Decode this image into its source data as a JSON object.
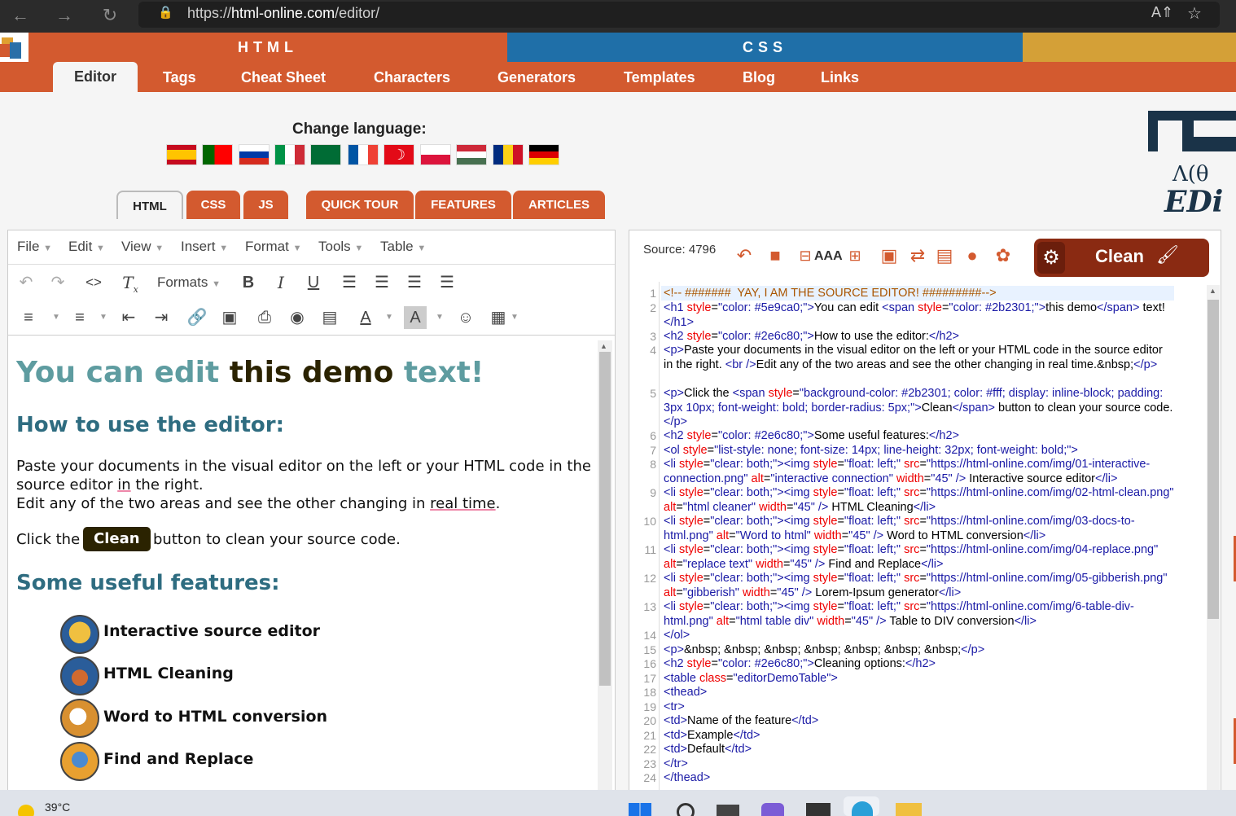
{
  "browser": {
    "url_prefix": "https://",
    "url_domain": "html-online.com",
    "url_path": "/editor/"
  },
  "header": {
    "html_band": "HTML",
    "css_band": "CSS"
  },
  "nav": [
    "Editor",
    "Tags",
    "Cheat Sheet",
    "Characters",
    "Generators",
    "Templates",
    "Blog",
    "Links"
  ],
  "language": {
    "label": "Change language:",
    "flags": [
      "es",
      "pt",
      "ru",
      "it",
      "sa",
      "fr",
      "tr",
      "pl",
      "hu",
      "ro",
      "de"
    ]
  },
  "tabs": [
    "HTML",
    "CSS",
    "JS",
    "QUICK TOUR",
    "FEATURES",
    "ARTICLES"
  ],
  "menus": [
    "File",
    "Edit",
    "View",
    "Insert",
    "Format",
    "Tools",
    "Table"
  ],
  "formats_label": "Formats",
  "editor": {
    "h1a": "You can edit ",
    "h1b": "this demo",
    "h1c": " text!",
    "h2a": "How to use the editor:",
    "p1a": "Paste your documents in the visual editor on the left or your HTML code in the",
    "p1b_pre": "source editor ",
    "p1b_in": "in",
    "p1b_post": " the right.",
    "p2_pre": "Edit any of the two areas and see the other changing in ",
    "p2_rt": "real time",
    "p2_post": ".",
    "click_pre": "Click the",
    "clean": "Clean",
    "click_post": "button to clean your source code.",
    "h2b": "Some useful features:",
    "features": [
      "Interactive source editor",
      "HTML Cleaning",
      "Word to HTML conversion",
      "Find and Replace"
    ]
  },
  "source": {
    "label": "Source: 4796",
    "clean_btn": "Clean",
    "font_label": "AAA"
  },
  "taskbar": {
    "temp": "39°C"
  }
}
